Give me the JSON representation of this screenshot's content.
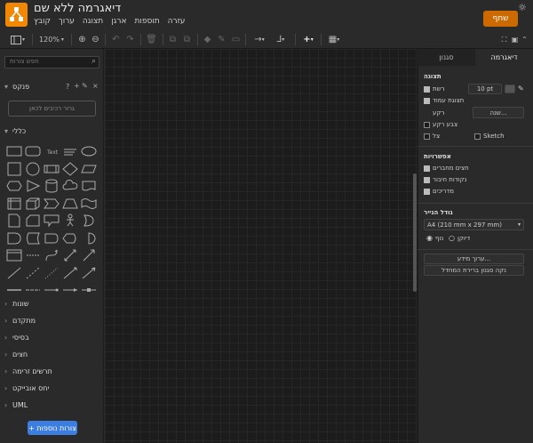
{
  "header": {
    "title": "דיאגרמה ללא שם",
    "menus": [
      "קובץ",
      "ערוך",
      "תצוגה",
      "ארגן",
      "תוספות",
      "עזרה"
    ],
    "share_label": "שתף"
  },
  "toolbar": {
    "zoom": "120%"
  },
  "left": {
    "search_placeholder": "חפש צורות",
    "scratchpad": {
      "label": "פנקס"
    },
    "drop_text": "גרור רכיבים לכאן",
    "general_label": "כללי",
    "sections": [
      "שונות",
      "מתקדם",
      "בסיסי",
      "חצים",
      "תרשים זרימה",
      "יחס אובייקט",
      "UML"
    ],
    "more_shapes": "+ צורות נוספות"
  },
  "right": {
    "tabs": [
      "סגנון",
      "דיאגרמה"
    ],
    "view": {
      "heading": "תצוגה",
      "grid": "רשת",
      "grid_size": "10 pt",
      "page_view": "תצוגת עמוד",
      "background": "רקע",
      "edit_btn": "שנה...",
      "bg_color": "צבע רקע",
      "shadow": "צל",
      "sketch": "Sketch"
    },
    "options": {
      "heading": "אפשרויות",
      "conn_arrows": "חצים מחברים",
      "conn_points": "נקודות חיבור",
      "guides": "מדריכים"
    },
    "paper": {
      "heading": "גודל הנייר",
      "size": "A4 (210 mm x 297 mm)",
      "portrait": "נוף",
      "landscape": "דיוקן"
    },
    "buttons": {
      "edit_data": "ערוך מידע...",
      "clear_default": "נקה סגנון ברירת המחדל"
    }
  },
  "colors": {
    "accent": "#f08705",
    "share": "#cc6a00",
    "more_shapes": "#3c7ee0"
  }
}
